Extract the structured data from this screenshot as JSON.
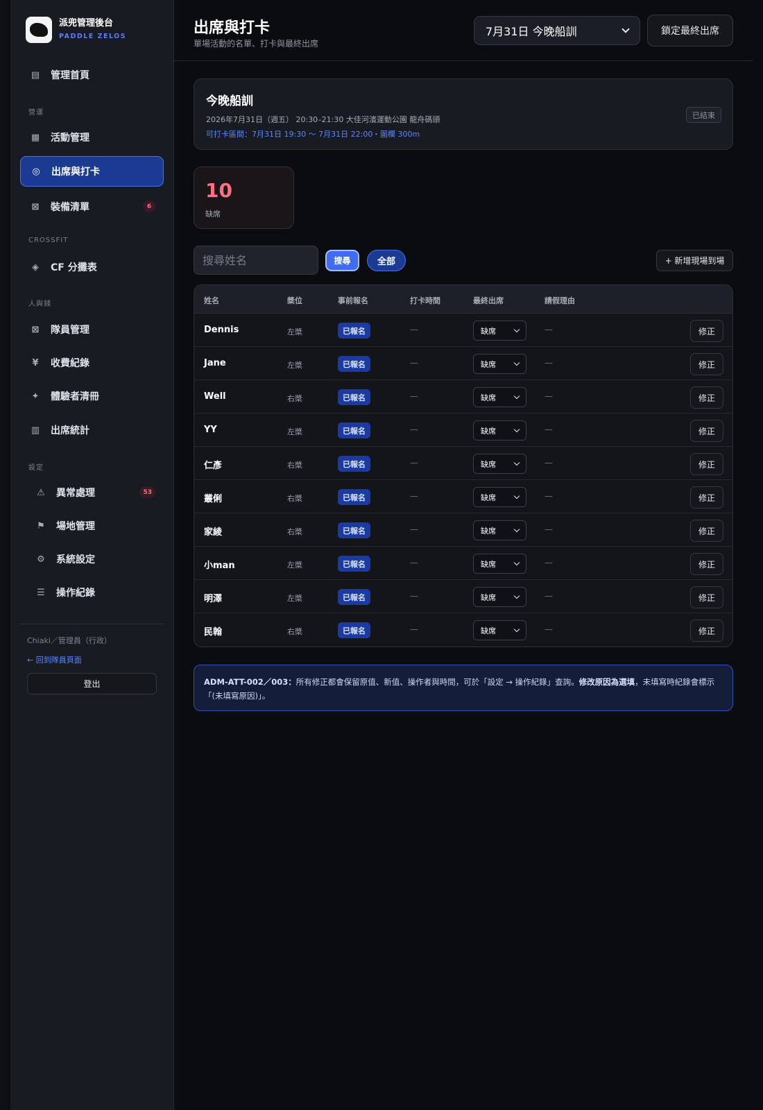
{
  "brand": {
    "name": "派兜管理後台",
    "sub": "PADDLE ZELOS"
  },
  "nav": {
    "home": "管理首頁",
    "section_ops": "營運",
    "events": "活動管理",
    "attendance": "出席與打卡",
    "equipment": "裝備清單",
    "equipment_badge": "6",
    "section_crossfit": "CROSSFIT",
    "cf_groups": "CF 分攤表",
    "section_people": "人與錢",
    "members": "隊員管理",
    "payments": "收費紀錄",
    "trial": "體驗者清冊",
    "stats": "出席統計",
    "section_settings": "設定",
    "exceptions": "異常處理",
    "exceptions_badge": "53",
    "venues": "場地管理",
    "system": "系統設定",
    "logs": "操作紀錄"
  },
  "user": {
    "line": "Chiaki／管理員（行政）",
    "back": "← 回到隊員頁面",
    "logout": "登出"
  },
  "header": {
    "title": "出席與打卡",
    "subtitle": "單場活動的名單、打卡與最終出席",
    "event_select": "7月31日 今晚船訓",
    "lock_button": "鎖定最終出席"
  },
  "event": {
    "name": "今晚船訓",
    "meta": "2026年7月31日（週五） 20:30–21:30 大佳河濱運動公園 龍舟碼頭",
    "window": "可打卡區間：7月31日 19:30 〜 7月31日 22:00",
    "radius": "・圍欄 300m",
    "status": "已結束"
  },
  "stats": {
    "absent_count": "10",
    "absent_label": "缺席"
  },
  "search": {
    "placeholder": "搜尋姓名",
    "search_button": "搜尋",
    "all_button": "全部",
    "walkin_button": "+ 新增現場到場"
  },
  "table": {
    "headers": {
      "name": "姓名",
      "side": "槳位",
      "registered": "事前報名",
      "checkin": "打卡時間",
      "final": "最終出席",
      "leave": "請假理由"
    },
    "rows": [
      {
        "name": "Dennis",
        "side": "左槳",
        "registered": "已報名",
        "checkin": "—",
        "final": "缺席",
        "leave": "—",
        "action": "修正"
      },
      {
        "name": "Jane",
        "side": "左槳",
        "registered": "已報名",
        "checkin": "—",
        "final": "缺席",
        "leave": "—",
        "action": "修正"
      },
      {
        "name": "Well",
        "side": "右槳",
        "registered": "已報名",
        "checkin": "—",
        "final": "缺席",
        "leave": "—",
        "action": "修正"
      },
      {
        "name": "YY",
        "side": "左槳",
        "registered": "已報名",
        "checkin": "—",
        "final": "缺席",
        "leave": "—",
        "action": "修正"
      },
      {
        "name": "仁彥",
        "side": "右槳",
        "registered": "已報名",
        "checkin": "—",
        "final": "缺席",
        "leave": "—",
        "action": "修正"
      },
      {
        "name": "叢俐",
        "side": "右槳",
        "registered": "已報名",
        "checkin": "—",
        "final": "缺席",
        "leave": "—",
        "action": "修正"
      },
      {
        "name": "家綾",
        "side": "右槳",
        "registered": "已報名",
        "checkin": "—",
        "final": "缺席",
        "leave": "—",
        "action": "修正"
      },
      {
        "name": "小man",
        "side": "左槳",
        "registered": "已報名",
        "checkin": "—",
        "final": "缺席",
        "leave": "—",
        "action": "修正"
      },
      {
        "name": "明澤",
        "side": "左槳",
        "registered": "已報名",
        "checkin": "—",
        "final": "缺席",
        "leave": "—",
        "action": "修正"
      },
      {
        "name": "民翰",
        "side": "右槳",
        "registered": "已報名",
        "checkin": "—",
        "final": "缺席",
        "leave": "—",
        "action": "修正"
      }
    ]
  },
  "note": {
    "code": "ADM-ATT-002／003：",
    "text1": "所有修正都會保留原值、新值、操作者與時間，可於「設定 → 操作紀錄」查詢。",
    "bold": "修改原因為選填",
    "text2": "，未填寫時紀錄會標示「(未填寫原因)」。"
  },
  "colors": {
    "accent": "#3f6cf0",
    "active_nav": "#1b3a93",
    "danger": "#ff6f82",
    "background": "#0b0c10"
  }
}
